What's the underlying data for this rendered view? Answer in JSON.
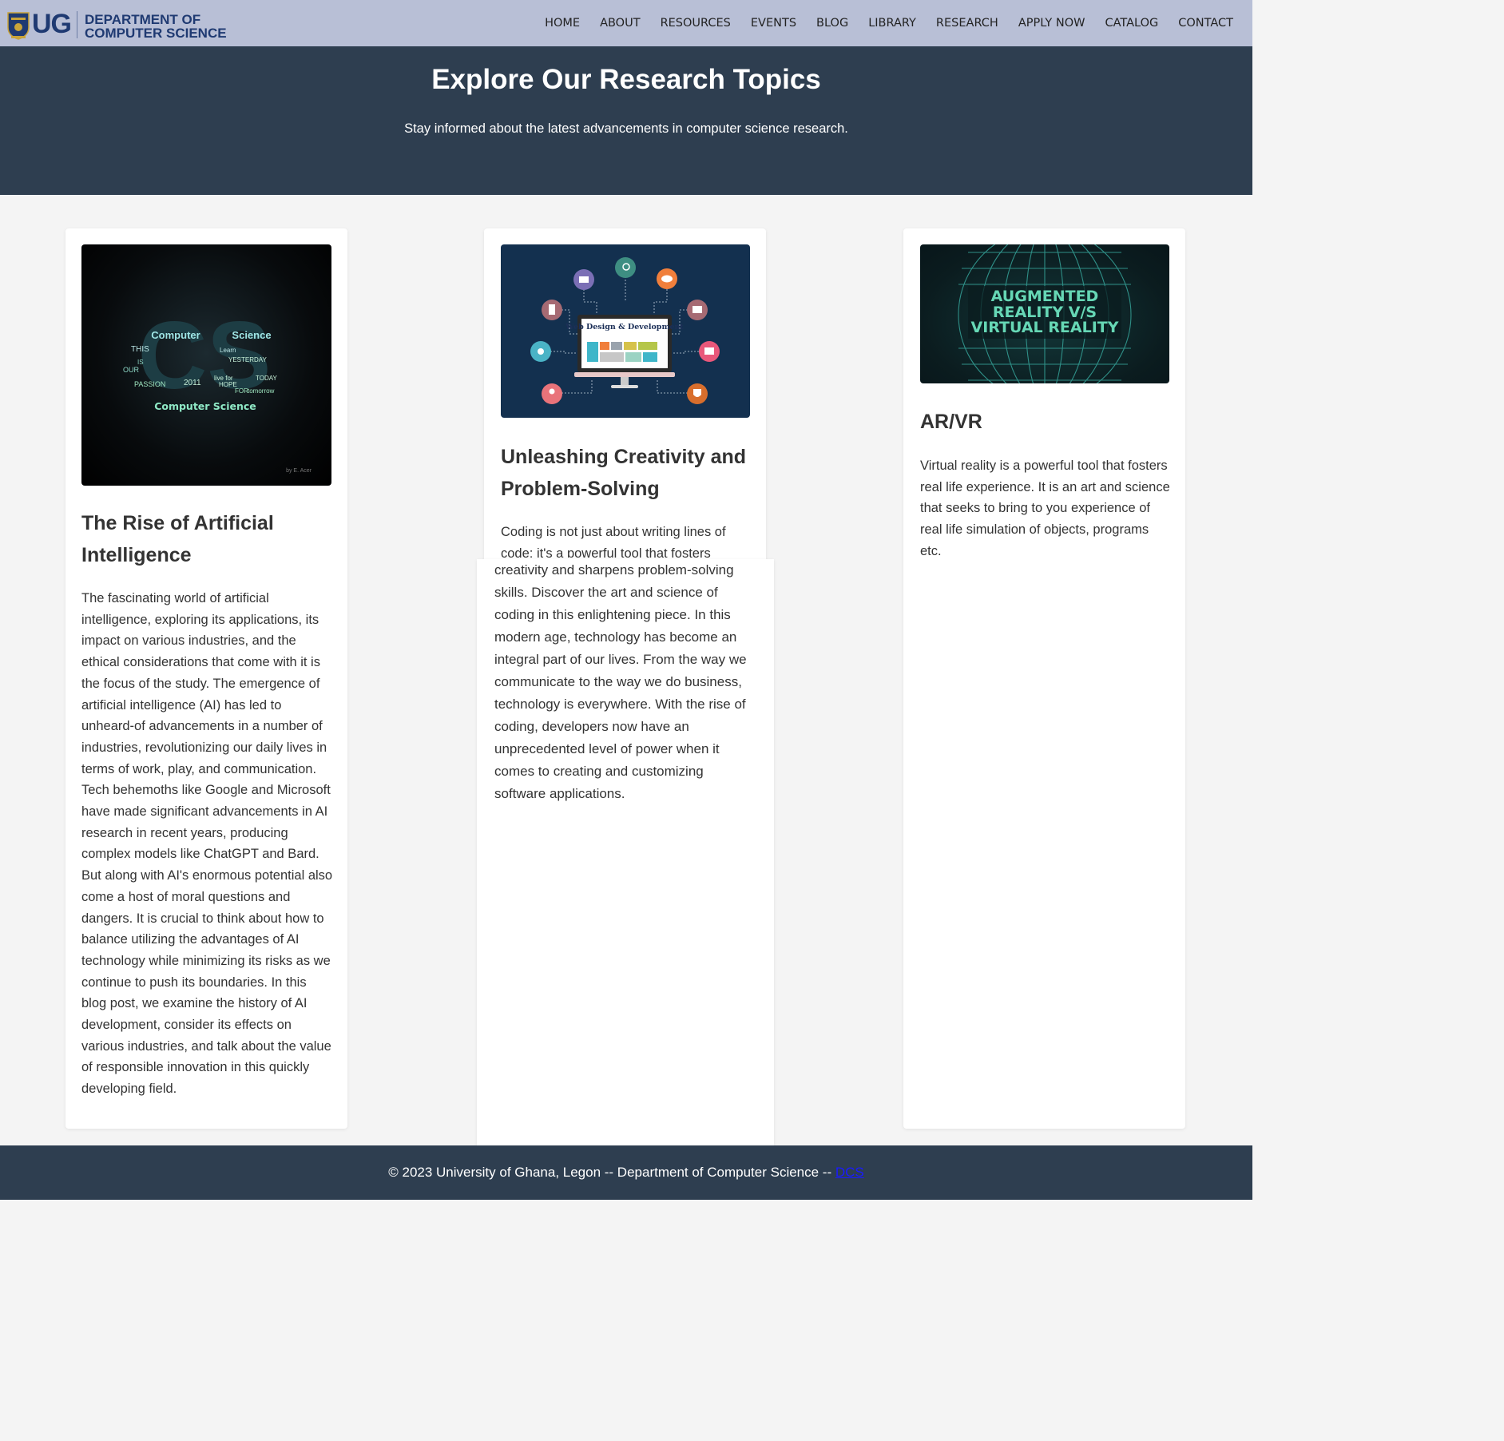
{
  "header": {
    "logo_text": "UG",
    "dept_line1": "DEPARTMENT OF",
    "dept_line2": "COMPUTER SCIENCE",
    "nav": [
      "HOME",
      "ABOUT",
      "RESOURCES",
      "EVENTS",
      "BLOG",
      "LIBRARY",
      "RESEARCH",
      "APPLY NOW",
      "CATALOG",
      "CONTACT"
    ]
  },
  "hero": {
    "title": "Explore Our Research Topics",
    "subtitle": "Stay informed about the latest advancements in computer science research."
  },
  "cards": [
    {
      "title": "The Rise of Artificial Intelligence",
      "text": "The fascinating world of artificial intelligence, exploring its applications, its impact on various industries, and the ethical considerations that come with it is the focus of the study. The emergence of artificial intelligence (AI) has led to unheard-of advancements in a number of industries, revolutionizing our daily lives in terms of work, play, and communication. Tech behemoths like Google and Microsoft have made significant advancements in AI research in recent years, producing complex models like ChatGPT and Bard. But along with AI's enormous potential also come a host of moral questions and dangers. It is crucial to think about how to balance utilizing the advantages of AI technology while minimizing its risks as we continue to push its boundaries. In this blog post, we examine the history of AI development, consider its effects on various industries, and talk about the value of responsible innovation in this quickly developing field.",
      "image": {
        "cs_letters": "CS",
        "caption": "Computer Science",
        "credit": "by E. Acer",
        "words": [
          "Computer",
          "Science",
          "THIS",
          "IS",
          "OUR",
          "PASSION",
          "2011",
          "YESTERDAY",
          "TODAY",
          "FOR",
          "tomorrow",
          "live for",
          "HOPE",
          "Learn"
        ]
      }
    },
    {
      "title": "Unleashing Creativity and Problem-Solving",
      "text_intro": "Coding is not just about writing lines of code; it's a powerful tool that fosters",
      "text_rest": "creativity and sharpens problem-solving skills. Discover the art and science of coding in this enlightening piece. In this modern age, technology has become an integral part of our lives. From the way we communicate to the way we do business, technology is everywhere. With the rise of coding, developers now have an unprecedented level of power when it comes to creating and customizing software applications.",
      "image": {
        "screen_text": "Web Design & Development"
      }
    },
    {
      "title": "AR/VR",
      "text": "Virtual reality is a powerful tool that fosters real life experience. It is an art and science that seeks to bring to you experience of real life simulation of objects, programs etc.",
      "image": {
        "line1": "AUGMENTED",
        "line2": "REALITY V/S",
        "line3": "VIRTUAL REALITY"
      }
    }
  ],
  "footer": {
    "text": "© 2023 University of Ghana, Legon -- Department of Computer Science -- ",
    "link": "DCS"
  }
}
